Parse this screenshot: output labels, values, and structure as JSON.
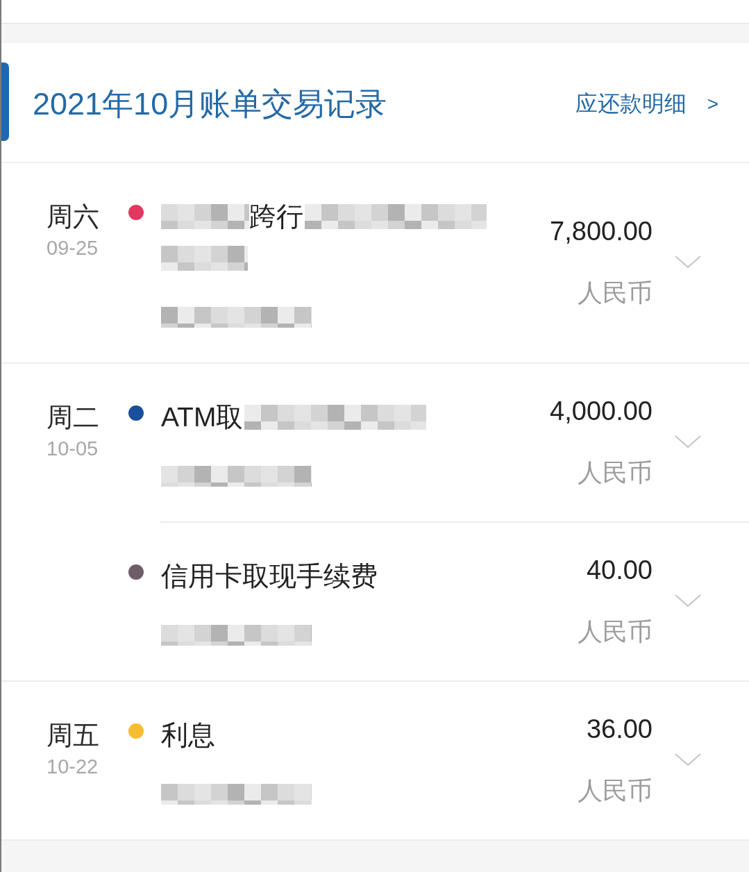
{
  "header": {
    "title": "2021年10月账单交易记录",
    "link": {
      "label": "应还款明细",
      "arrow": ">"
    }
  },
  "days": [
    {
      "weekday": "周六",
      "date": "09-25",
      "transactions": [
        {
          "color": "#e2375f",
          "title_lines": [
            [
              {
                "kind": "redacted"
              },
              {
                "kind": "text",
                "text": "跨行"
              },
              {
                "kind": "redacted"
              }
            ],
            [
              {
                "kind": "redacted"
              }
            ]
          ],
          "detail_redacted": true,
          "amount": "7,800.00",
          "currency": "人民币",
          "expanded": false
        }
      ]
    },
    {
      "weekday": "周二",
      "date": "10-05",
      "transactions": [
        {
          "color": "#1b4f9c",
          "title_lines": [
            [
              {
                "kind": "text",
                "text": "ATM取"
              },
              {
                "kind": "redacted"
              }
            ]
          ],
          "detail_redacted": true,
          "amount": "4,000.00",
          "currency": "人民币",
          "expanded": false
        },
        {
          "color": "#6d5d69",
          "title_lines": [
            [
              {
                "kind": "text",
                "text": "信用卡取现手续费"
              }
            ]
          ],
          "detail_redacted": true,
          "amount": "40.00",
          "currency": "人民币",
          "expanded": false
        }
      ]
    },
    {
      "weekday": "周五",
      "date": "10-22",
      "transactions": [
        {
          "color": "#f6bd33",
          "title_lines": [
            [
              {
                "kind": "text",
                "text": "利息"
              }
            ]
          ],
          "detail_redacted": true,
          "amount": "36.00",
          "currency": "人民币",
          "expanded": false
        }
      ]
    }
  ]
}
